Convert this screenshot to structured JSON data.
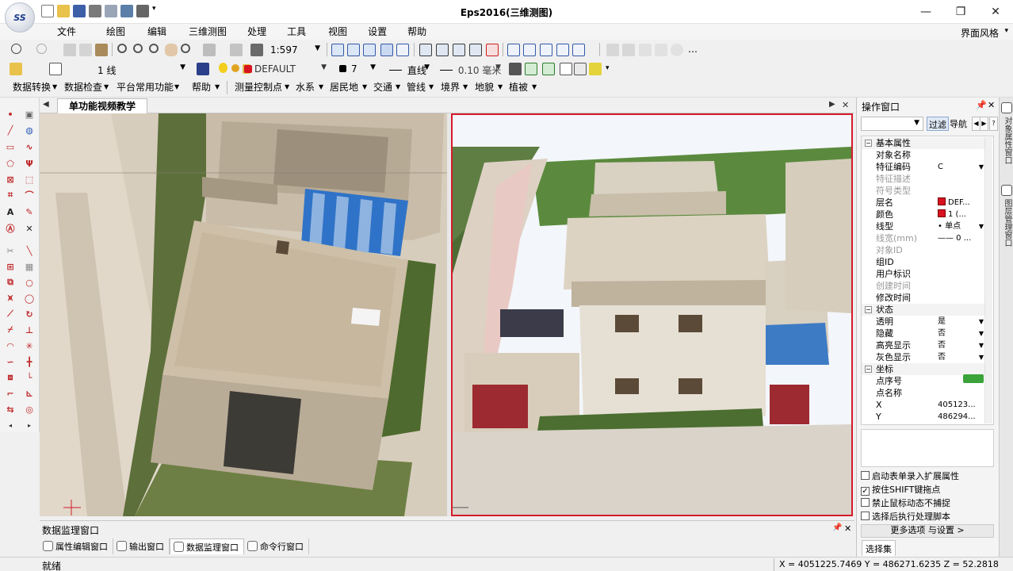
{
  "window": {
    "title": "Eps2016(三维测图)",
    "logo_text": "SS",
    "controls": [
      "—",
      "❐",
      "✕"
    ]
  },
  "menu": {
    "items": [
      "文件",
      "绘图",
      "编辑",
      "三维测图",
      "处理",
      "工具",
      "视图",
      "设置",
      "帮助"
    ],
    "ui_style": "界面风格"
  },
  "toolbar1": {
    "scale": "1:597"
  },
  "toolbar2": {
    "layer_code": "1 线",
    "layer_name": "DEFAULT",
    "color_code": "7",
    "linetype": "直线",
    "line_width": "0.10 毫米"
  },
  "toolbar3": {
    "items": [
      "数据转换",
      "数据检查",
      "平台常用功能",
      "帮助",
      "测量控制点",
      "水系",
      "居民地",
      "交通",
      "管线",
      "境界",
      "地貌",
      "植被"
    ]
  },
  "document": {
    "tab_label": "单功能视频教学"
  },
  "monitor": {
    "title": "数据监理窗口",
    "tabs": [
      "属性编辑窗口",
      "输出窗口",
      "数据监理窗口",
      "命令行窗口"
    ],
    "active_tab": "数据监理窗口"
  },
  "status": {
    "text": "就绪",
    "coords": "X = 4051225.7469 Y = 486271.6235 Z = 52.2818"
  },
  "panel": {
    "title": "操作窗口",
    "filter_label": "过滤",
    "nav_label": "导航",
    "sections": {
      "basic": "基本属性",
      "state": "状态",
      "coord": "坐标"
    },
    "props_basic": [
      {
        "name": "对象名称",
        "value": "",
        "disabled": false
      },
      {
        "name": "特征编码",
        "value": "C",
        "disabled": false,
        "dropdown": true
      },
      {
        "name": "特征描述",
        "value": "",
        "disabled": true
      },
      {
        "name": "符号类型",
        "value": "",
        "disabled": true
      },
      {
        "name": "层名",
        "value": "DEF...",
        "disabled": false,
        "swatch": true
      },
      {
        "name": "颜色",
        "value": "1 (...",
        "disabled": false,
        "swatch": true
      },
      {
        "name": "线型",
        "value": "• 单点",
        "disabled": false,
        "dropdown": true
      },
      {
        "name": "线宽(mm)",
        "value": "—— 0 ...",
        "disabled": true
      },
      {
        "name": "对象ID",
        "value": "",
        "disabled": true
      },
      {
        "name": "组ID",
        "value": "",
        "disabled": false
      },
      {
        "name": "用户标识",
        "value": "",
        "disabled": false
      },
      {
        "name": "创建时间",
        "value": "",
        "disabled": true
      },
      {
        "name": "修改时间",
        "value": "",
        "disabled": false
      }
    ],
    "props_state": [
      {
        "name": "透明",
        "value": "是"
      },
      {
        "name": "隐藏",
        "value": "否"
      },
      {
        "name": "高亮显示",
        "value": "否"
      },
      {
        "name": "灰色显示",
        "value": "否"
      }
    ],
    "props_coord": [
      {
        "name": "点序号",
        "value": ""
      },
      {
        "name": "点名称",
        "value": ""
      },
      {
        "name": "X",
        "value": "405123..."
      },
      {
        "name": "Y",
        "value": "486294..."
      }
    ],
    "options": [
      {
        "label": "启动表单录入扩展属性",
        "checked": false
      },
      {
        "label": "按住SHIFT键拖点",
        "checked": true
      },
      {
        "label": "禁止鼠标动态不捕捉",
        "checked": false
      },
      {
        "label": "选择后执行处理脚本",
        "checked": false
      }
    ],
    "more_options": "更多选项 与设置 >",
    "selection_tab": "选择集",
    "side_tabs": [
      "对象属性窗口",
      "图层管理窗口"
    ]
  },
  "colors": {
    "accent_red": "#d41b2b",
    "toolbar_bg": "#f0f0f0"
  }
}
